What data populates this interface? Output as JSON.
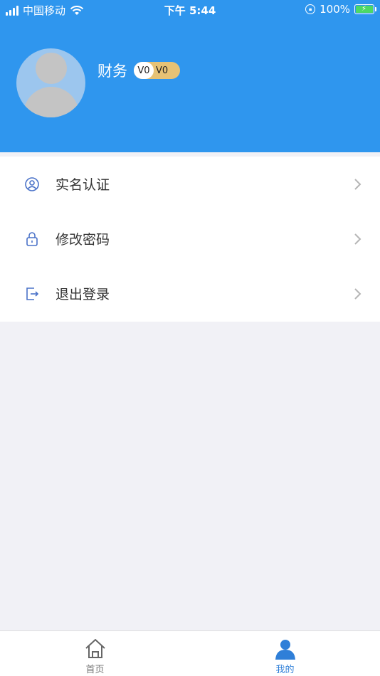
{
  "status_bar": {
    "carrier": "中国移动",
    "time": "下午 5:44",
    "battery": "100%"
  },
  "profile": {
    "name": "财务",
    "level_badge_left": "V0",
    "level_badge_right": "V0"
  },
  "menu": {
    "items": [
      {
        "label": "实名认证",
        "icon": "user-circle-icon"
      },
      {
        "label": "修改密码",
        "icon": "lock-icon"
      },
      {
        "label": "退出登录",
        "icon": "logout-icon"
      }
    ]
  },
  "tabbar": {
    "home_label": "首页",
    "mine_label": "我的"
  },
  "colors": {
    "header": "#2f96ee",
    "badge": "#e6c275",
    "active_tab": "#2f7fd8",
    "icon": "#4a72c8"
  }
}
